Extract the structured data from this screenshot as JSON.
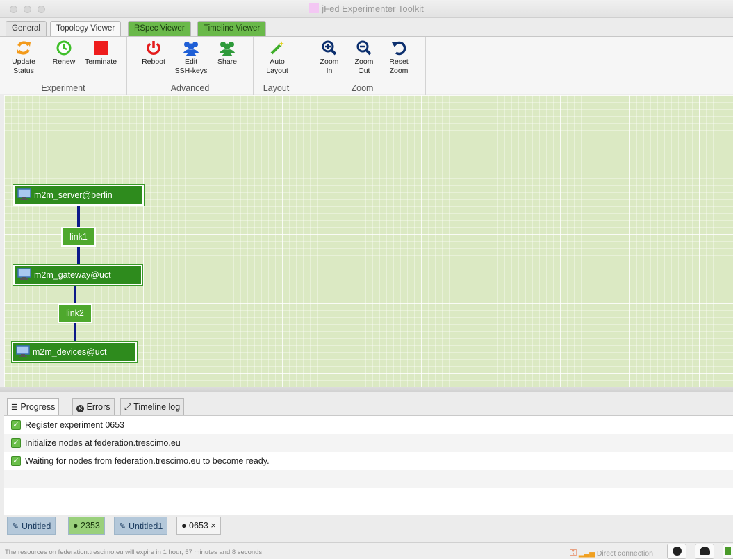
{
  "window": {
    "title": "jFed Experimenter Toolkit"
  },
  "tabs": [
    {
      "label": "General"
    },
    {
      "label": "Topology Viewer"
    },
    {
      "label": "RSpec Viewer"
    },
    {
      "label": "Timeline Viewer"
    }
  ],
  "ribbon": {
    "groups": [
      {
        "label": "Experiment"
      },
      {
        "label": "Advanced"
      },
      {
        "label": "Layout"
      },
      {
        "label": "Zoom"
      }
    ],
    "buttons": {
      "update_status": "Update\nStatus",
      "renew": "Renew",
      "terminate": "Terminate",
      "reboot": "Reboot",
      "edit_ssh_keys": "Edit\nSSH-keys",
      "share": "Share",
      "auto_layout": "Auto\nLayout",
      "zoom_in": "Zoom\nIn",
      "zoom_out": "Zoom\nOut",
      "reset_zoom": "Reset\nZoom"
    }
  },
  "topology": {
    "nodes": [
      {
        "label": "m2m_server@berlin"
      },
      {
        "label": "m2m_gateway@uct"
      },
      {
        "label": "m2m_devices@uct"
      }
    ],
    "links": [
      {
        "label": "link1"
      },
      {
        "label": "link2"
      }
    ]
  },
  "log_tabs": [
    {
      "label": "Progress",
      "icon": "list-icon"
    },
    {
      "label": "Errors",
      "icon": "error-icon"
    },
    {
      "label": "Timeline log",
      "icon": "expand-icon"
    }
  ],
  "log_entries": [
    {
      "text": "Register experiment 0653"
    },
    {
      "text": "Initialize nodes at federation.trescimo.eu"
    },
    {
      "text": "Waiting for nodes from federation.trescimo.eu to become ready."
    }
  ],
  "doc_tabs": [
    {
      "label": "Untitled"
    },
    {
      "label": "2353"
    },
    {
      "label": "Untitled1"
    },
    {
      "label": "0653"
    }
  ],
  "status_bar": {
    "message": "The resources on federation.trescimo.eu will expire in 1 hour, 57 minutes and 8 seconds.",
    "connection": "Direct connection"
  },
  "colors": {
    "canvas_bg": "#dbe9c3",
    "node_green": "#2e8b1d",
    "link_green": "#4ea82d",
    "edge_blue": "#0d1a8a"
  }
}
